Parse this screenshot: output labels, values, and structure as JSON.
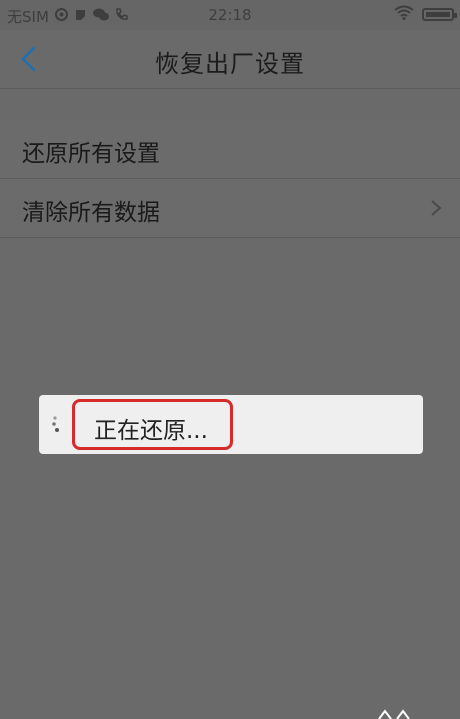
{
  "status_bar": {
    "carrier": "无SIM",
    "time": "22:18",
    "icons": [
      "notification-icon",
      "app-icon",
      "wechat-icon",
      "phone-icon",
      "wifi-icon",
      "battery-icon"
    ]
  },
  "header": {
    "title": "恢复出厂设置",
    "back_icon": "chevron-left-icon",
    "accent_color": "#1f6fb0"
  },
  "list": {
    "items": [
      {
        "label": "还原所有设置",
        "has_chevron": false
      },
      {
        "label": "清除所有数据",
        "has_chevron": true
      }
    ]
  },
  "dialog": {
    "message": "正在还原...",
    "highlight_color": "#d72a2a"
  }
}
